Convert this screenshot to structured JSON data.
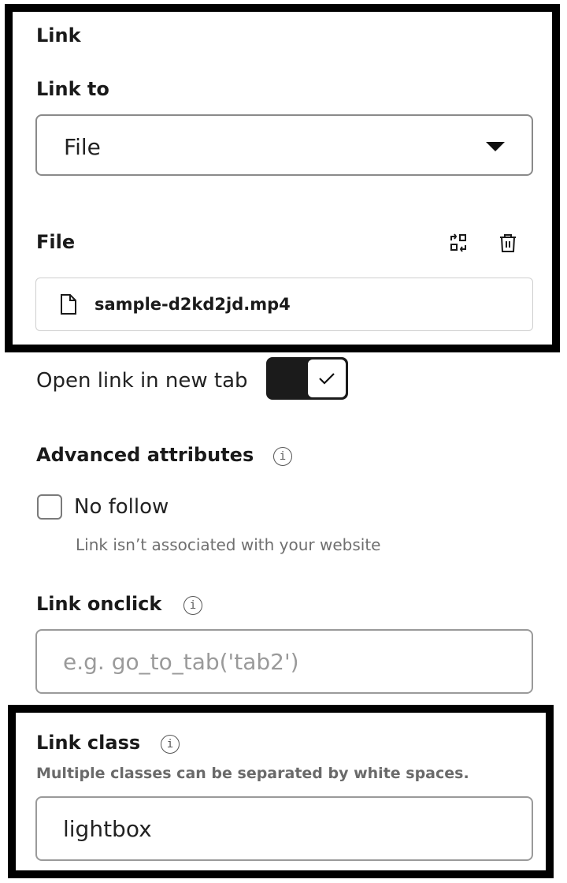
{
  "section_link": {
    "title": "Link",
    "link_to_label": "Link to",
    "link_to_value": "File",
    "file_label": "File",
    "file_name": "sample-d2kd2jd.mp4"
  },
  "open_new_tab": {
    "label": "Open link in new tab",
    "enabled": true
  },
  "advanced": {
    "title": "Advanced attributes",
    "no_follow_label": "No follow",
    "no_follow_help": "Link isn’t associated with your website"
  },
  "onclick": {
    "label": "Link onclick",
    "placeholder": "e.g. go_to_tab('tab2')",
    "value": ""
  },
  "link_class": {
    "label": "Link class",
    "help": "Multiple classes can be separated by white spaces.",
    "value": "lightbox"
  },
  "icons": {
    "caret": "chevron-down-icon",
    "replace": "replace-file-icon",
    "delete": "trash-icon",
    "file": "file-icon",
    "check": "check-icon",
    "info": "info-icon"
  }
}
